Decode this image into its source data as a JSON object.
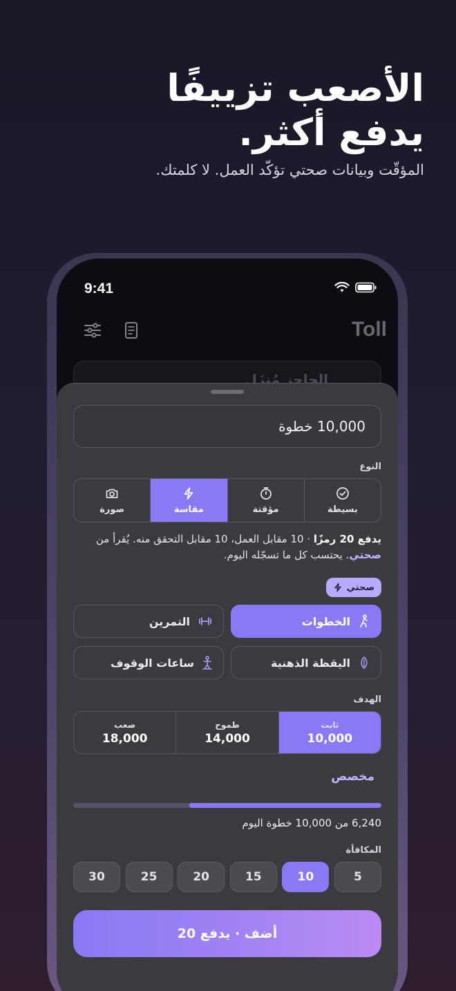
{
  "hero": {
    "title_line1": "الأصعب تزييفًا",
    "title_line2": "يدفع أكثر.",
    "subtitle": "المؤقّت وبيانات صحتي تؤكّد العمل. لا كلمتك."
  },
  "status_bar": {
    "time": "9:41"
  },
  "app": {
    "brand": "Toll",
    "behind_card_title": "الحاجز مُنزَل"
  },
  "sheet": {
    "amount_value": "10,000 خطوة",
    "type_label": "النوع",
    "types": [
      {
        "label": "بسيطة",
        "icon": "check-circle-icon",
        "active": false
      },
      {
        "label": "مؤقتة",
        "icon": "timer-icon",
        "active": false
      },
      {
        "label": "مقاسة",
        "icon": "bolt-icon",
        "active": true
      },
      {
        "label": "صورة",
        "icon": "camera-icon",
        "active": false
      }
    ],
    "desc_bold": "يدفع 20 رمزًا",
    "desc_mid": " · 10 مقابل العمل، 10 مقابل التحقق منه. يُقرأ من ",
    "desc_link": "صحتي",
    "desc_end": ". يحتسب كل ما تسجّله اليوم.",
    "health_chip": "صحتي",
    "metrics": [
      {
        "label": "الخطوات",
        "icon": "walking-icon",
        "active": true
      },
      {
        "label": "التمرين",
        "icon": "dumbbell-icon",
        "active": false
      },
      {
        "label": "اليقظة الذهنية",
        "icon": "leaf-icon",
        "active": false
      },
      {
        "label": "ساعات الوقوف",
        "icon": "standing-icon",
        "active": false
      }
    ],
    "goal_label": "الهدف",
    "goals": [
      {
        "name": "ثابت",
        "value": "10,000",
        "active": true
      },
      {
        "name": "طموح",
        "value": "14,000",
        "active": false
      },
      {
        "name": "صعب",
        "value": "18,000",
        "active": false
      }
    ],
    "custom_label": "مخصص",
    "progress_fraction": 0.624,
    "progress_text": "6,240 من 10,000 خطوة اليوم",
    "reward_label": "المكافأة",
    "rewards": [
      "5",
      "10",
      "15",
      "20",
      "25",
      "30"
    ],
    "reward_selected": "10",
    "cta_label": "أضف · يدفع 20"
  },
  "colors": {
    "accent": "#8a79f5",
    "sheet": "#3b3b3f",
    "background": "#191725"
  }
}
